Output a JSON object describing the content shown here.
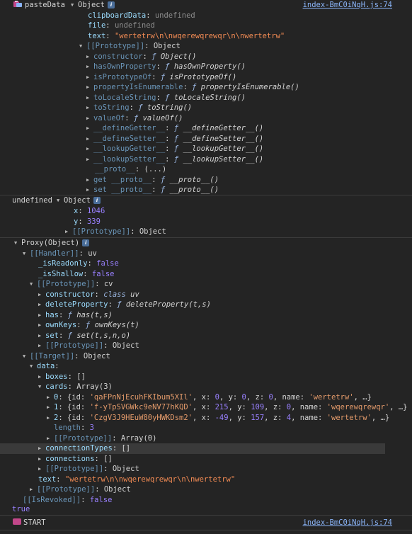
{
  "log_entries": {
    "paste_label": "pasteData",
    "source1": "index-BmC0iNqH.js:74",
    "undefined_label": "undefined",
    "true_label": "true",
    "start_label": "START",
    "source2": "index-BmC0iNqH.js:74"
  },
  "paste": {
    "summary": "Object",
    "clipboardData_key": "clipboardData",
    "clipboardData_val": "undefined",
    "file_key": "file",
    "file_val": "undefined",
    "text_key": "text",
    "text_val": "\"wertetrw\\n\\nwqerewqrewqr\\n\\nwertetrw\"",
    "proto_key": "[[Prototype]]",
    "proto_val": "Object",
    "proto_members": [
      {
        "key": "constructor",
        "val": "Object()"
      },
      {
        "key": "hasOwnProperty",
        "val": "hasOwnProperty()"
      },
      {
        "key": "isPrototypeOf",
        "val": "isPrototypeOf()"
      },
      {
        "key": "propertyIsEnumerable",
        "val": "propertyIsEnumerable()"
      },
      {
        "key": "toLocaleString",
        "val": "toLocaleString()"
      },
      {
        "key": "toString",
        "val": "toString()"
      },
      {
        "key": "valueOf",
        "val": "valueOf()"
      },
      {
        "key": "__defineGetter__",
        "val": "__defineGetter__()"
      },
      {
        "key": "__defineSetter__",
        "val": "__defineSetter__()"
      },
      {
        "key": "__lookupGetter__",
        "val": "__lookupGetter__()"
      },
      {
        "key": "__lookupSetter__",
        "val": "__lookupSetter__()"
      }
    ],
    "proto_getter_key": "__proto__",
    "proto_getter_val": "(...)",
    "get_proto_key": "get __proto__",
    "get_proto_val": "__proto__()",
    "set_proto_key": "set __proto__",
    "set_proto_val": "__proto__()"
  },
  "coords": {
    "summary": "Object",
    "x_key": "x",
    "x_val": "1046",
    "y_key": "y",
    "y_val": "339",
    "proto_key": "[[Prototype]]",
    "proto_val": "Object"
  },
  "proxy": {
    "summary": "Proxy(Object)",
    "handler_key": "[[Handler]]",
    "handler_val": "uv",
    "isReadonly_key": "_isReadonly",
    "isReadonly_val": "false",
    "isShallow_key": "_isShallow",
    "isShallow_val": "false",
    "hproto_key": "[[Prototype]]",
    "hproto_val": "cv",
    "constructor_key": "constructor",
    "constructor_val": "uv",
    "deleteProperty_key": "deleteProperty",
    "deleteProperty_val": "deleteProperty(t,s)",
    "has_key": "has",
    "has_val": "has(t,s)",
    "ownKeys_key": "ownKeys",
    "ownKeys_val": "ownKeys(t)",
    "set_key": "set",
    "set_val": "set(t,s,n,o)",
    "hproto2_key": "[[Prototype]]",
    "hproto2_val": "Object",
    "target_key": "[[Target]]",
    "target_val": "Object",
    "data_key": "data",
    "boxes_key": "boxes",
    "boxes_val": "[]",
    "cards_key": "cards",
    "cards_val": "Array(3)",
    "cards": [
      {
        "index": "0",
        "id": "'qaFPnNjEcuhFKIbum5XIl'",
        "x": "0",
        "y": "0",
        "z": "0",
        "name": "'wertetrw'"
      },
      {
        "index": "1",
        "id": "'f-yTpSVGWkc9eNV77hKQD'",
        "x": "215",
        "y": "109",
        "z": "0",
        "name": "'wqerewqrewqr'"
      },
      {
        "index": "2",
        "id": "'CzgV3J9HEuW80yHWKDsm2'",
        "x": "-49",
        "y": "157",
        "z": "4",
        "name": "'wertetrw'"
      }
    ],
    "length_key": "length",
    "length_val": "3",
    "cproto_key": "[[Prototype]]",
    "cproto_val": "Array(0)",
    "connectionTypes_key": "connectionTypes",
    "connectionTypes_val": "[]",
    "connections_key": "connections",
    "connections_val": "[]",
    "dproto_key": "[[Prototype]]",
    "dproto_val": "Object",
    "text_key": "text",
    "text_val": "\"wertetrw\\n\\nwqerewqrewqr\\n\\nwertetrw\"",
    "tproto_key": "[[Prototype]]",
    "tproto_val": "Object",
    "revoked_key": "[[IsRevoked]]",
    "revoked_val": "false"
  },
  "colors": {
    "background": "#242424",
    "key": "#9cdcfe",
    "string": "#f28b54",
    "number": "#9980ff",
    "link": "#8ab4f8"
  }
}
